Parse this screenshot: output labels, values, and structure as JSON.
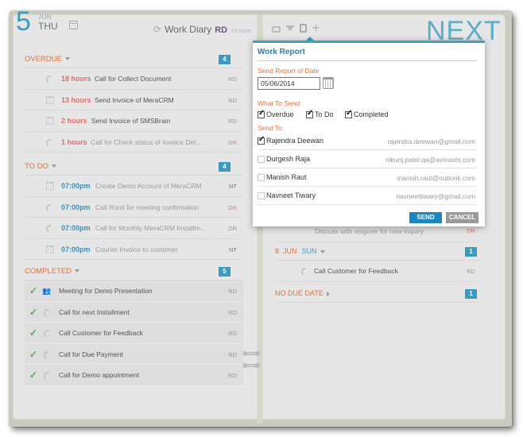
{
  "header": {
    "day": "5",
    "month": "JUN",
    "weekday": "THU",
    "diary_title": "Work Diary",
    "user": "RD",
    "more": "+3 more",
    "next_label": "NEXT"
  },
  "overdue": {
    "title": "OVERDUE",
    "count": "4",
    "items": [
      {
        "icon": "phone-icon",
        "time": "18 hours",
        "title": "Call for Collect Document",
        "who": "RD"
      },
      {
        "icon": "calendar-icon",
        "time": "13 hours",
        "title": "Send Invoice of MeraCRM",
        "who": "RD"
      },
      {
        "icon": "calendar-icon",
        "time": "2 hours",
        "title": "Send Invoice of SMSBrain",
        "who": "RD"
      },
      {
        "icon": "phone-icon",
        "time": "1 hours",
        "title": "Call for Check status of Invoice Del...",
        "who": "DR"
      }
    ]
  },
  "todo": {
    "title": "TO DO",
    "count": "4",
    "items": [
      {
        "icon": "calendar-icon",
        "time": "07:00pm",
        "title": "Create Demo Account of MeraCRM",
        "who": "NT"
      },
      {
        "icon": "phone-icon",
        "time": "07:00pm",
        "title": "Call Ronit for meeting confirmation",
        "who": "DR"
      },
      {
        "icon": "phone-icon",
        "time": "07:00pm",
        "title": "Call for Monthly MeraCRM Installm...",
        "who": "DR"
      },
      {
        "icon": "calendar-icon",
        "time": "07:00pm",
        "title": "Courier Invoice to customer",
        "who": "NT"
      }
    ]
  },
  "completed": {
    "title": "COMPLETED",
    "count": "5",
    "items": [
      {
        "icon": "people-icon",
        "title": "Meeting for Demo Presentation",
        "who": "RD"
      },
      {
        "icon": "phone-icon",
        "title": "Call for next Installment",
        "who": "RD"
      },
      {
        "icon": "phone-icon",
        "title": "Call Customer for Feedback",
        "who": "RD"
      },
      {
        "icon": "phone-icon",
        "title": "Call for Due Payment",
        "who": "RD"
      },
      {
        "icon": "phone-icon",
        "title": "Call for Demo appointment",
        "who": "RD"
      }
    ]
  },
  "right": {
    "hidden_row": {
      "title": "Discuss with asignee for new inquiry",
      "who": "DR"
    },
    "sun_section": {
      "date": "8",
      "month": "JUN",
      "weekday": "SUN",
      "count": "1",
      "items": [
        {
          "icon": "phone-icon",
          "title": "Call Customer for Feedback",
          "who": "RD"
        }
      ]
    },
    "no_due": {
      "title": "NO DUE DATE",
      "count": "1"
    }
  },
  "work_report": {
    "title": "Work Report",
    "date_label": "Send Report of Date",
    "date_value": "05/06/2014",
    "what_label": "What To Send",
    "what_options": [
      {
        "label": "Overdue",
        "checked": true
      },
      {
        "label": "To Do",
        "checked": true
      },
      {
        "label": "Completed",
        "checked": true
      }
    ],
    "send_to_label": "Send To",
    "recipients": [
      {
        "name": "Rajendra Deewan",
        "email": "rajendra.deewan@gmail.com",
        "checked": true
      },
      {
        "name": "Durgesh Raja",
        "email": "nikunj.patel.qa@avinashi.com",
        "checked": false
      },
      {
        "name": "Manish Raut",
        "email": "manish.raut@outlook.com",
        "checked": false
      },
      {
        "name": "Navneet Tiwary",
        "email": "navneettiwary@gmail.com",
        "checked": false
      }
    ],
    "send_label": "SEND",
    "cancel_label": "CANCEL"
  }
}
